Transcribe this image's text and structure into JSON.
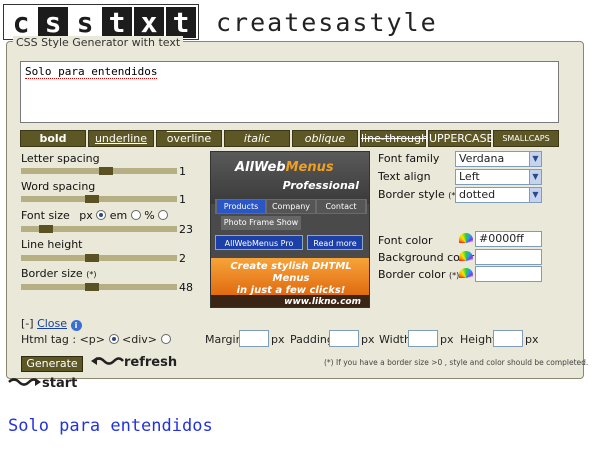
{
  "header": {
    "logo_letters": [
      "c",
      "s",
      "s",
      "t",
      "x",
      "t"
    ],
    "tagline": "createsastyle"
  },
  "panel": {
    "legend": "CSS Style Generator with text",
    "text_value": "Solo para entendidos"
  },
  "style_buttons": [
    "bold",
    "underline",
    "overline",
    "italic",
    "oblique",
    "line-through",
    "UPPERCASE",
    "SMALLCAPS"
  ],
  "sliders": {
    "letter_spacing": {
      "label": "Letter spacing",
      "value": "1",
      "fraction": 0.55
    },
    "word_spacing": {
      "label": "Word spacing",
      "value": "1",
      "fraction": 0.45
    },
    "font_size": {
      "label": "Font size",
      "unit_label": "px",
      "em_label": "em",
      "pct_label": "%",
      "value": "23",
      "fraction": 0.13
    },
    "line_height": {
      "label": "Line height",
      "value": "2",
      "fraction": 0.45
    },
    "border_size": {
      "label": "Border size",
      "note": "(*)",
      "value": "48",
      "fraction": 0.45
    }
  },
  "ad": {
    "brand_part1": "AllWeb",
    "brand_part2": "Menus",
    "edition": "Professional",
    "tabs": [
      "Products",
      "Company",
      "Contact"
    ],
    "sub_item": "Photo Frame Show",
    "btn_primary": "AllWebMenus Pro",
    "btn_more": "Read more",
    "slogan_1": "Create stylish DHTML Menus",
    "slogan_2": "in just a few clicks!",
    "url": "www.likno.com"
  },
  "right": {
    "font_family": {
      "label": "Font family",
      "value": "Verdana"
    },
    "text_align": {
      "label": "Text align",
      "value": "Left"
    },
    "border_style": {
      "label": "Border style",
      "note": "(*)",
      "value": "dotted"
    },
    "font_color": {
      "label": "Font color",
      "value": "#0000ff"
    },
    "background_color": {
      "label": "Background color",
      "value": ""
    },
    "border_color": {
      "label": "Border color",
      "note": "(*)",
      "value": ""
    }
  },
  "bottom": {
    "close_prefix": "[-]",
    "close_label": "Close",
    "info": "i",
    "html_tag_label": "Html tag :",
    "tag_p": "<p>",
    "tag_div": "<div>",
    "margin_label": "Margin",
    "padding_label": "Padding",
    "width_label": "Width",
    "height_label": "Height",
    "px": "px",
    "generate_label": "Generate",
    "refresh_label": "refresh",
    "start_label": "start",
    "note": "(*) If you have a border size >0 , style and color should be completed."
  },
  "output_text": "Solo para entendidos"
}
